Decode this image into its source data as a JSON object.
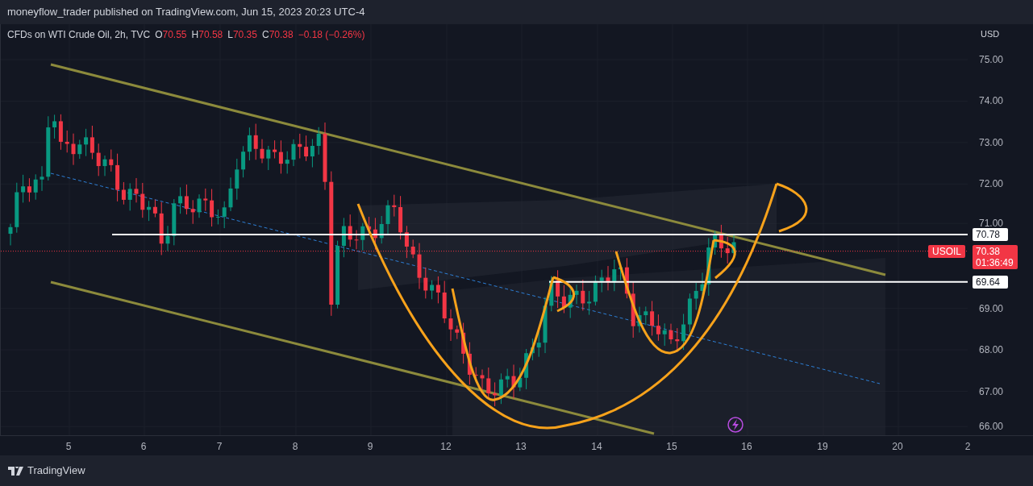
{
  "header": {
    "published": "moneyflow_trader published on TradingView.com, Jun 15, 2023 20:23 UTC-4"
  },
  "legend": {
    "title": "CFDs on WTI Crude Oil, 2h, TVC",
    "ohlc": [
      {
        "label": "O",
        "value": "70.55"
      },
      {
        "label": "H",
        "value": "70.58"
      },
      {
        "label": "L",
        "value": "70.35"
      },
      {
        "label": "C",
        "value": "70.38"
      }
    ],
    "change": "−0.18 (−0.26%)"
  },
  "price_axis": {
    "currency": "USD",
    "ticks": [
      "75.00",
      "74.00",
      "73.00",
      "72.00",
      "71.00",
      "69.00",
      "68.00",
      "67.00",
      "66.00"
    ],
    "markers": [
      {
        "kind": "line",
        "value": "70.78"
      },
      {
        "kind": "last",
        "symbol": "USOIL",
        "value": "70.38",
        "countdown": "01:36:49"
      },
      {
        "kind": "line",
        "value": "69.64"
      }
    ]
  },
  "time_axis": {
    "ticks": [
      "5",
      "6",
      "7",
      "8",
      "9",
      "12",
      "13",
      "14",
      "15",
      "16",
      "19",
      "20",
      "2"
    ]
  },
  "footer": {
    "brand": "TradingView"
  }
}
